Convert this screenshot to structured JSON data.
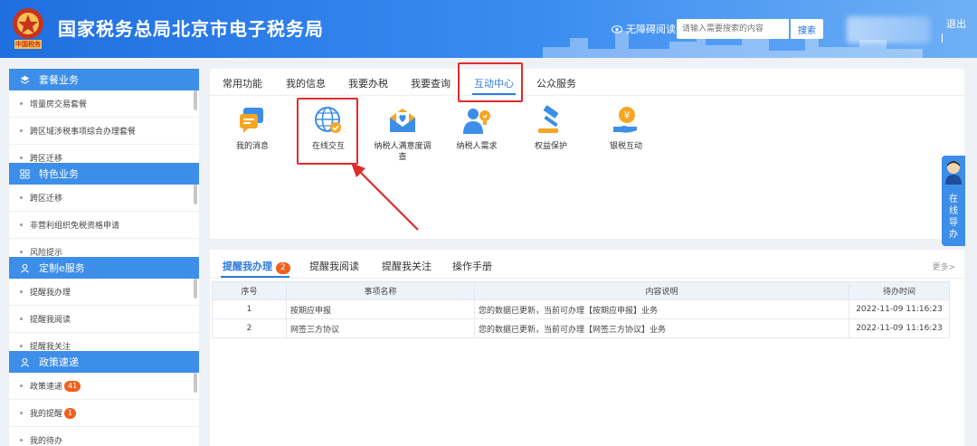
{
  "header": {
    "site_title": "国家税务总局北京市电子税务局",
    "emblem_text": "中国税务",
    "accessible_label": "无障碍阅读",
    "search_placeholder": "请输入需要搜索的内容",
    "search_button": "搜索",
    "logout_label": "退出"
  },
  "sidebar": {
    "sections": [
      {
        "title": "套餐业务",
        "icon": "layers-icon",
        "items": [
          {
            "label": "增量房交易套餐"
          },
          {
            "label": "跨区域涉税事项综合办理套餐"
          },
          {
            "label": "跨区迁移"
          }
        ]
      },
      {
        "title": "特色业务",
        "icon": "grid-icon",
        "items": [
          {
            "label": "跨区迁移"
          },
          {
            "label": "非营利组织免税资格申请"
          },
          {
            "label": "风险提示"
          }
        ]
      },
      {
        "title": "定制e服务",
        "icon": "user-icon",
        "items": [
          {
            "label": "提醒我办理"
          },
          {
            "label": "提醒我阅读"
          },
          {
            "label": "提醒我关注"
          }
        ]
      },
      {
        "title": "政策速递",
        "icon": "user-icon",
        "items": [
          {
            "label": "政策速递",
            "badge": "41"
          },
          {
            "label": "我的提醒",
            "badge": "1"
          },
          {
            "label": "我的待办"
          }
        ]
      }
    ]
  },
  "main_tabs": [
    {
      "label": "常用功能"
    },
    {
      "label": "我的信息"
    },
    {
      "label": "我要办税"
    },
    {
      "label": "我要查询"
    },
    {
      "label": "互动中心"
    },
    {
      "label": "公众服务"
    }
  ],
  "features": [
    {
      "label": "我的消息",
      "icon": "message-icon"
    },
    {
      "label": "在线交互",
      "icon": "globe-icon"
    },
    {
      "label": "纳税人满意度调查",
      "icon": "mail-heart-icon"
    },
    {
      "label": "纳税人需求",
      "icon": "person-idea-icon"
    },
    {
      "label": "权益保护",
      "icon": "gavel-icon"
    },
    {
      "label": "银税互动",
      "icon": "yuan-hand-icon"
    }
  ],
  "float_help": {
    "label": "在线导办"
  },
  "bottom_tabs": [
    {
      "label": "提醒我办理",
      "badge": "2"
    },
    {
      "label": "提醒我阅读"
    },
    {
      "label": "提醒我关注"
    },
    {
      "label": "操作手册"
    }
  ],
  "more_label": "更多>",
  "table": {
    "headers": [
      "序号",
      "事项名称",
      "内容说明",
      "待办时间"
    ],
    "rows": [
      [
        "1",
        "按期应申报",
        "您的数据已更新，当前可办理【按期应申报】业务",
        "2022-11-09 11:16:23"
      ],
      [
        "2",
        "网签三方协议",
        "您的数据已更新，当前可办理【网签三方协议】业务",
        "2022-11-09 11:16:23"
      ]
    ]
  },
  "colors": {
    "primary": "#2f7be0",
    "sidebar_header": "#3d8ee8",
    "badge": "#f0601f",
    "highlight": "#e02b2b"
  }
}
